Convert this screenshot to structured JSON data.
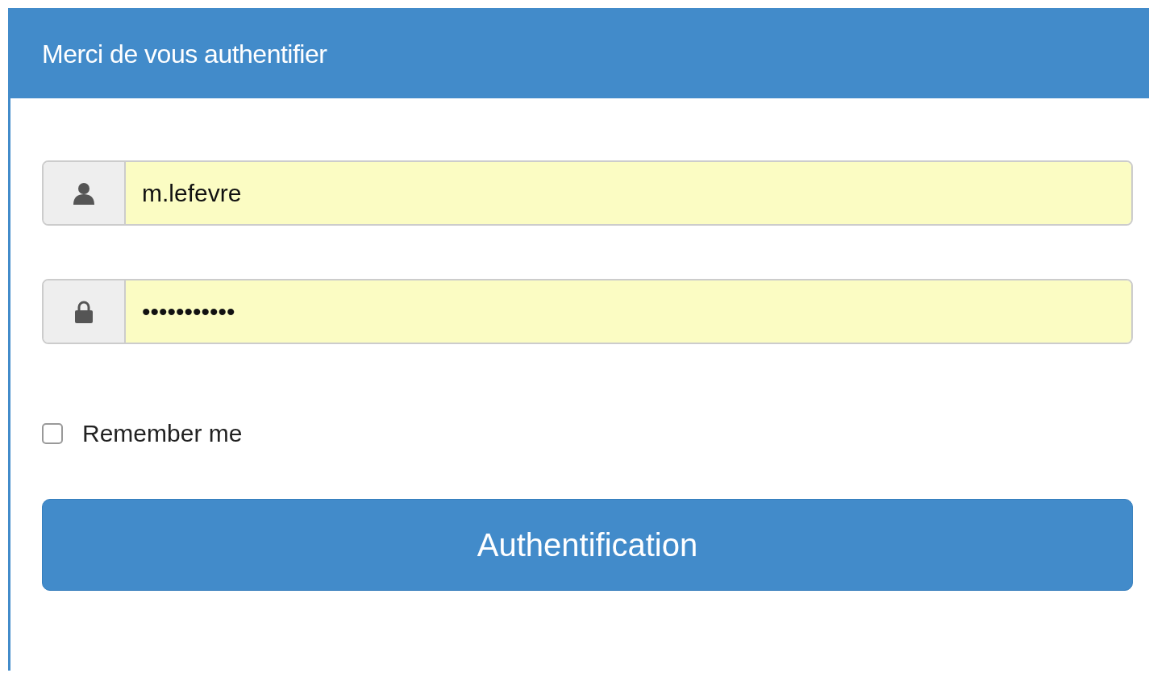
{
  "panel": {
    "title": "Merci de vous authentifier"
  },
  "fields": [
    {
      "kind": "user",
      "value": "m.lefevre"
    },
    {
      "kind": "lock",
      "value": "•••••••••••"
    }
  ],
  "remember": {
    "label": "Remember me",
    "checked": false
  },
  "submit": {
    "label": "Authentification"
  }
}
